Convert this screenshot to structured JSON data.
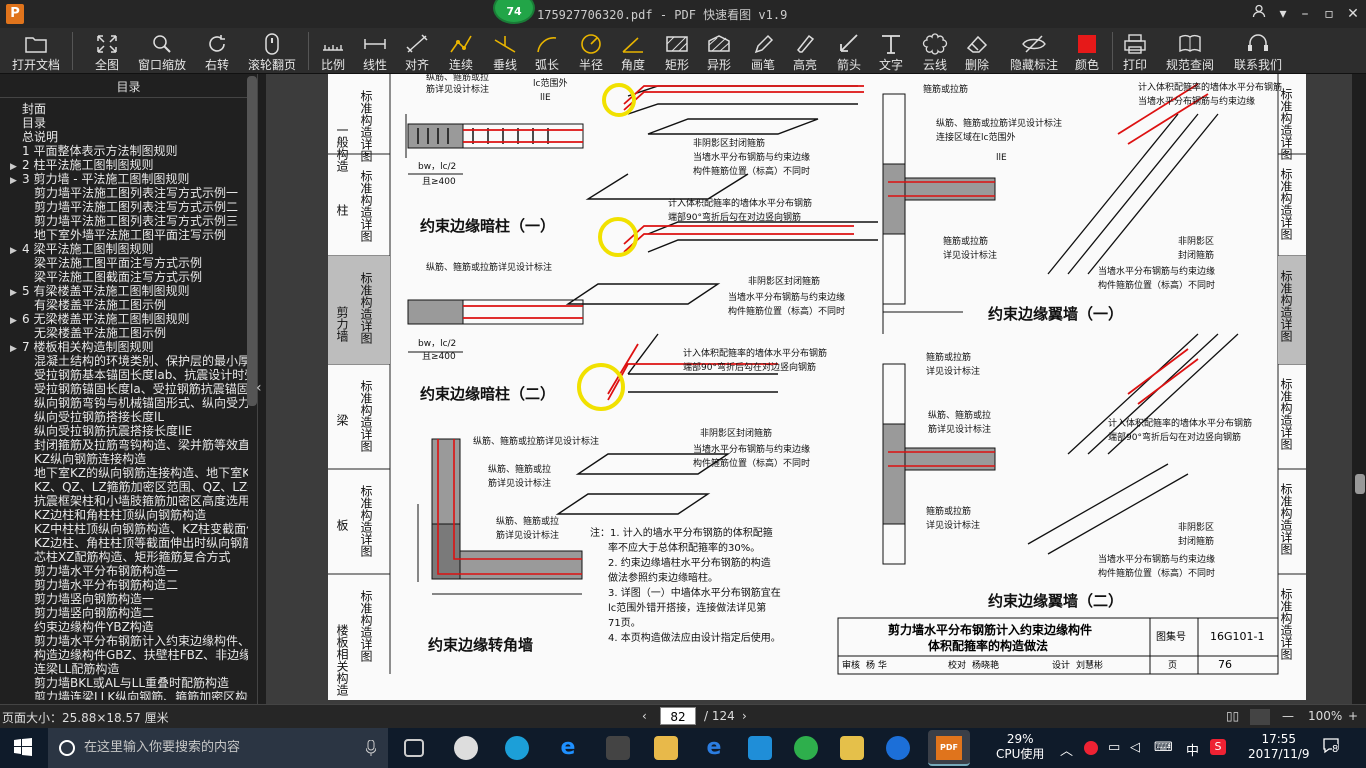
{
  "app": {
    "logo": "P",
    "badge": "74",
    "title": "175927706320.pdf - PDF 快速看图 v1.9"
  },
  "toolbar": {
    "items": [
      "打开文档",
      "全图",
      "窗口缩放",
      "右转",
      "滚轮翻页",
      "比例",
      "线性",
      "对齐",
      "连续",
      "垂线",
      "弧长",
      "半径",
      "角度",
      "矩形",
      "异形",
      "画笔",
      "高亮",
      "箭头",
      "文字",
      "云线",
      "删除",
      "隐藏标注",
      "颜色",
      "打印",
      "规范查阅",
      "联系我们"
    ],
    "color_swatch": "#e61919"
  },
  "sidebar": {
    "title": "目录",
    "items": [
      {
        "label": "封面",
        "arrow": ""
      },
      {
        "label": "目录",
        "arrow": ""
      },
      {
        "label": "总说明",
        "arrow": ""
      },
      {
        "label": "1 平面整体表示方法制图规则",
        "arrow": ""
      },
      {
        "label": "2 柱平法施工图制图规则",
        "arrow": "▶"
      },
      {
        "label": "3 剪力墙 - 平法施工图制图规则",
        "arrow": "▶"
      },
      {
        "label": "剪力墙平法施工图列表注写方式示例一",
        "arrow": ""
      },
      {
        "label": "剪力墙平法施工图列表注写方式示例二",
        "arrow": ""
      },
      {
        "label": "剪力墙平法施工图列表注写方式示例三",
        "arrow": ""
      },
      {
        "label": "地下室外墙平法施工图平面注写示例",
        "arrow": ""
      },
      {
        "label": "4 梁平法施工图制图规则",
        "arrow": "▶"
      },
      {
        "label": "梁平法施工图平面注写方式示例",
        "arrow": ""
      },
      {
        "label": "梁平法施工图截面注写方式示例",
        "arrow": ""
      },
      {
        "label": "5 有梁楼盖平法施工图制图规则",
        "arrow": "▶"
      },
      {
        "label": "有梁楼盖平法施工图示例",
        "arrow": ""
      },
      {
        "label": "6 无梁楼盖平法施工图制图规则",
        "arrow": "▶"
      },
      {
        "label": "无梁楼盖平法施工图示例",
        "arrow": ""
      },
      {
        "label": "7 楼板相关构造制图规则",
        "arrow": "▶"
      },
      {
        "label": "混凝土结构的环境类别、保护层的最小厚度",
        "arrow": ""
      },
      {
        "label": "受拉钢筋基本锚固长度lab、抗震设计时受",
        "arrow": ""
      },
      {
        "label": "受拉钢筋锚固长度la、受拉钢筋抗震锚固长",
        "arrow": ""
      },
      {
        "label": "纵向钢筋弯钩与机械锚固形式、纵向受力钢",
        "arrow": ""
      },
      {
        "label": "纵向受拉钢筋搭接长度lL",
        "arrow": ""
      },
      {
        "label": "纵向受拉钢筋抗震搭接长度llE",
        "arrow": ""
      },
      {
        "label": "封闭箍筋及拉筋弯钩构造、梁并筋等效直径",
        "arrow": ""
      },
      {
        "label": "KZ纵向钢筋连接构造",
        "arrow": ""
      },
      {
        "label": "地下室KZ的纵向钢筋连接构造、地下室KZ的",
        "arrow": ""
      },
      {
        "label": "KZ、QZ、LZ箍筋加密区范围、QZ、LZ纵向钢",
        "arrow": ""
      },
      {
        "label": "抗震框架柱和小墙肢箍筋加密区高度选用表",
        "arrow": ""
      },
      {
        "label": "KZ边柱和角柱柱顶纵向钢筋构造",
        "arrow": ""
      },
      {
        "label": "KZ中柱柱顶纵向钢筋构造、KZ柱变截面位置",
        "arrow": ""
      },
      {
        "label": "KZ边柱、角柱柱顶等截面伸出时纵向钢筋构",
        "arrow": ""
      },
      {
        "label": "芯柱XZ配筋构造、矩形箍筋复合方式",
        "arrow": ""
      },
      {
        "label": "剪力墙水平分布钢筋构造一",
        "arrow": ""
      },
      {
        "label": "剪力墙水平分布钢筋构造二",
        "arrow": ""
      },
      {
        "label": "剪力墙竖向钢筋构造一",
        "arrow": ""
      },
      {
        "label": "剪力墙竖向钢筋构造二",
        "arrow": ""
      },
      {
        "label": "约束边缘构件YBZ构造",
        "arrow": ""
      },
      {
        "label": "剪力墙水平分布钢筋计入约束边缘构件、剪",
        "arrow": ""
      },
      {
        "label": "构造边缘构件GBZ、扶壁柱FBZ、非边缘暗柱",
        "arrow": ""
      },
      {
        "label": "连梁LL配筋构造",
        "arrow": ""
      },
      {
        "label": "剪力墙BKL或AL与LL重叠时配筋构造",
        "arrow": ""
      },
      {
        "label": "剪力墙连梁LLK纵向钢筋、箍筋加密区构造",
        "arrow": ""
      }
    ]
  },
  "drawing": {
    "left_tabs": [
      {
        "a": "一般构造",
        "b": "标准构造详图"
      },
      {
        "a": "柱",
        "b": "标准构造详图"
      },
      {
        "a": "剪力墙",
        "b": "标准构造详图"
      },
      {
        "a": "梁",
        "b": "标准构造详图"
      },
      {
        "a": "板",
        "b": "标准构造详图"
      },
      {
        "a": "楼板相关构造",
        "b": "标准构造详图"
      }
    ],
    "right_tabs": [
      "标准构造详图",
      "标准构造详图",
      "标准构造详图",
      "标准构造详图",
      "标准构造详图",
      "标准构造详图"
    ],
    "captions": {
      "c1": "约束边缘暗柱（一）",
      "c2": "约束边缘暗柱（二）",
      "c3": "约束边缘转角墙",
      "c4": "约束边缘翼墙（一）",
      "c5": "约束边缘翼墙（二）"
    },
    "labels": {
      "l1": "纵筋、箍筋或拉",
      "l2": "筋详见设计标注",
      "l3": "lc范围外",
      "l4": "llE",
      "l5": "bw，lc/2",
      "l6": "且≥400",
      "l7": "非阴影区封闭箍筋",
      "l8": "当墙水平分布钢筋与约束边缘",
      "l9": "构件箍筋位置（标高）不同时",
      "l10": "计入体积配箍率的墙体水平分布钢筋",
      "l11": "端部90°弯折后勾在对边竖向钢筋",
      "l12": "纵筋、箍筋或拉筋详见设计标注",
      "l13": "非阴影区封闭箍筋",
      "l14": "当墙水平分布钢筋与约束边缘",
      "l15": "构件箍筋位置（标高）不同时",
      "l16": "纵筋、箍筋或拉筋详见设计标注",
      "l17": "bw，lc/2",
      "l18": "且≥400",
      "l19": "计入体积配箍率的墙体水平分布钢筋",
      "l20": "端部90°弯折后勾在对边竖向钢筋",
      "l21": "纵筋、箍筋或拉筋详见设计标注",
      "l22": "非阴影区封闭箍筋",
      "l23": "当墙水平分布钢筋与约束边缘",
      "l24": "构件箍筋位置（标高）不同时",
      "l25": "纵筋、箍筋或拉",
      "l26": "筋详见设计标注",
      "l27": "纵筋、箍筋或拉",
      "l28": "筋详见设计标注",
      "l29": "箍筋或拉筋",
      "l30": "详见设计标注",
      "l31": "纵筋、箍筋或拉筋详见设计标注",
      "l32": "连接区域在lc范围外",
      "l33": "llE",
      "l34": "箍筋或拉筋",
      "l35": "详见设计标注",
      "l36": "非阴影区",
      "l37": "封闭箍筋",
      "l38": "当墙水平分布钢筋与约束边缘",
      "l39": "构件箍筋位置（标高）不同时",
      "l40": "计入体积配箍率的墙体水平分布钢筋",
      "l41": "当墙水平分布钢筋与约束边缘",
      "l42": "箍筋或拉筋",
      "l43": "详见设计标注",
      "l44": "纵筋、箍筋或拉",
      "l45": "筋详见设计标注",
      "l46": "箍筋或拉筋",
      "l47": "详见设计标注",
      "l48": "计入体积配箍率的墙体水平分布钢筋",
      "l49": "端部90°弯折后勾在对边竖向钢筋",
      "l50": "非阴影区",
      "l51": "封闭箍筋",
      "l52": "当墙水平分布钢筋与约束边缘",
      "l53": "构件箍筋位置（标高）不同时"
    },
    "notes": [
      "注：1. 计入的墙水平分布钢筋的体积配箍",
      "率不应大于总体积配箍率的30%。",
      "2. 约束边缘墙柱水平分布钢筋的构造",
      "做法参照约束边缘暗柱。",
      "3. 详图（一）中墙体水平分布钢筋宜在",
      "lc范围外错开搭接，连接做法详见第",
      "71页。",
      "4. 本页构造做法应由设计指定后使用。"
    ],
    "titleblock": {
      "title1": "剪力墙水平分布钢筋计入约束边缘构件",
      "title2": "体积配箍率的构造做法",
      "atlas_label": "图集号",
      "atlas": "16G101-1",
      "review": "审核",
      "reviewer": "杨 华",
      "check": "校对",
      "checker": "杨晓艳",
      "design": "设计",
      "designer": "刘慧彬",
      "page_label": "页",
      "page": "76"
    }
  },
  "status": {
    "page_size": "页面大小：25.88×18.57 厘米",
    "current_page": "82",
    "total_pages": "/ 124",
    "zoom": "100%",
    "minus": "—",
    "plus": "+"
  },
  "taskbar": {
    "search_placeholder": "在这里输入你要搜索的内容",
    "cpu_pct": "29%",
    "cpu_label": "CPU使用",
    "time": "17:55",
    "date": "2017/11/9",
    "ime": "中",
    "notif": "8"
  }
}
